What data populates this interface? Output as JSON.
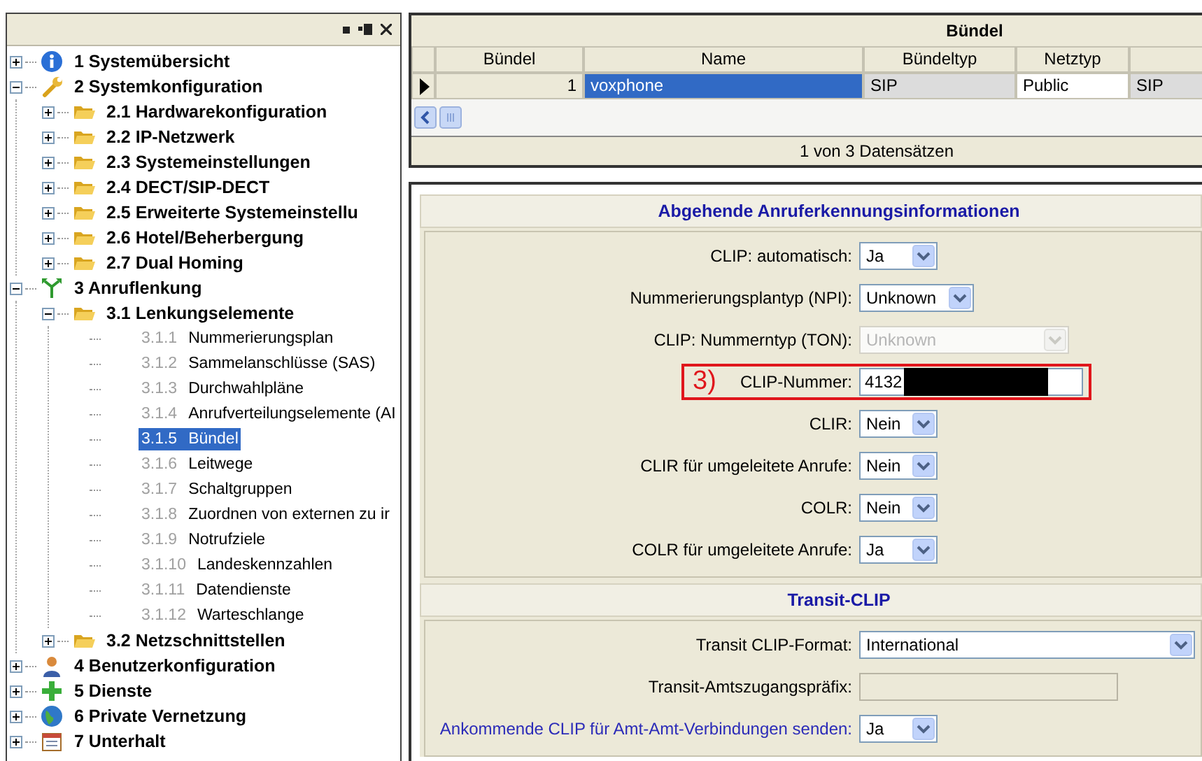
{
  "tree": [
    {
      "kind": "info",
      "label": "1 Systemübersicht",
      "expanded": false,
      "selected": false
    },
    {
      "kind": "wrench",
      "label": "2 Systemkonfiguration",
      "expanded": true,
      "selected": false,
      "children": [
        {
          "kind": "folder",
          "label": "2.1 Hardwarekonfiguration",
          "expanded": false,
          "selected": false
        },
        {
          "kind": "folder",
          "label": "2.2 IP-Netzwerk",
          "expanded": false,
          "selected": false
        },
        {
          "kind": "folder",
          "label": "2.3 Systemeinstellungen",
          "expanded": false,
          "selected": false
        },
        {
          "kind": "folder",
          "label": "2.4 DECT/SIP-DECT",
          "expanded": false,
          "selected": false
        },
        {
          "kind": "folder",
          "label": "2.5 Erweiterte Systemeinstellu",
          "expanded": false,
          "selected": false
        },
        {
          "kind": "folder",
          "label": "2.6 Hotel/Beherbergung",
          "expanded": false,
          "selected": false
        },
        {
          "kind": "folder",
          "label": "2.7 Dual Homing",
          "expanded": false,
          "selected": false
        }
      ]
    },
    {
      "kind": "routing",
      "label": "3 Anruflenkung",
      "expanded": true,
      "selected": false,
      "children": [
        {
          "kind": "folder",
          "label": "3.1 Lenkungselemente",
          "expanded": true,
          "selected": false,
          "children": [
            {
              "kind": "page",
              "number": "3.1.1",
              "label": "Nummerierungsplan",
              "selected": false
            },
            {
              "kind": "page",
              "number": "3.1.2",
              "label": "Sammelanschlüsse (SAS)",
              "selected": false
            },
            {
              "kind": "page",
              "number": "3.1.3",
              "label": "Durchwahlpläne",
              "selected": false
            },
            {
              "kind": "page",
              "number": "3.1.4",
              "label": "Anrufverteilungselemente (AI",
              "selected": false
            },
            {
              "kind": "page",
              "number": "3.1.5",
              "label": "Bündel",
              "selected": true
            },
            {
              "kind": "page",
              "number": "3.1.6",
              "label": "Leitwege",
              "selected": false
            },
            {
              "kind": "page",
              "number": "3.1.7",
              "label": "Schaltgruppen",
              "selected": false
            },
            {
              "kind": "page",
              "number": "3.1.8",
              "label": "Zuordnen von externen zu ir",
              "selected": false
            },
            {
              "kind": "page",
              "number": "3.1.9",
              "label": "Notrufziele",
              "selected": false
            },
            {
              "kind": "page",
              "number": "3.1.10",
              "label": "Landeskennzahlen",
              "selected": false
            },
            {
              "kind": "page",
              "number": "3.1.11",
              "label": "Datendienste",
              "selected": false
            },
            {
              "kind": "page",
              "number": "3.1.12",
              "label": "Warteschlange",
              "selected": false
            }
          ]
        },
        {
          "kind": "folder",
          "label": "3.2 Netzschnittstellen",
          "expanded": false,
          "selected": false
        }
      ]
    },
    {
      "kind": "user",
      "label": "4 Benutzerkonfiguration",
      "expanded": false,
      "selected": false
    },
    {
      "kind": "plus",
      "label": "5 Dienste",
      "expanded": false,
      "selected": false
    },
    {
      "kind": "globe",
      "label": "6 Private Vernetzung",
      "expanded": false,
      "selected": false
    },
    {
      "kind": "calendar",
      "label": "7 Unterhalt",
      "expanded": false,
      "selected": false
    }
  ],
  "grid": {
    "title": "Bündel",
    "columns": [
      "Bündel",
      "Name",
      "Bündeltyp",
      "Netztyp"
    ],
    "rows": [
      {
        "selected": true,
        "cells": [
          {
            "text": "1",
            "kind": "number"
          },
          {
            "text": "voxphone",
            "kind": "focused"
          },
          {
            "text": "SIP",
            "kind": "readonly"
          },
          {
            "text": "Public",
            "kind": "edit"
          },
          {
            "text": "SIP",
            "kind": "readonly"
          }
        ]
      }
    ],
    "records": "1 von 3 Datensätzen"
  },
  "sections": [
    {
      "title": "Abgehende Anruferkennungsinformationen",
      "fields": [
        {
          "label": "CLIP: automatisch:",
          "kind": "choice",
          "value": "Ja",
          "disabled": false,
          "highlighted": false
        },
        {
          "label": "Nummerierungsplantyp (NPI):",
          "kind": "dropdown",
          "value": "Unknown",
          "disabled": false,
          "highlighted": false
        },
        {
          "label": "CLIP: Nummerntyp (TON):",
          "kind": "list",
          "value": "Unknown",
          "disabled": true,
          "highlighted": false
        },
        {
          "label": "CLIP-Nummer:",
          "kind": "text",
          "value": "4132",
          "redacted": true,
          "annotation": "3)",
          "disabled": false,
          "highlighted": false
        },
        {
          "label": "CLIR:",
          "kind": "choice",
          "value": "Nein",
          "disabled": false,
          "highlighted": false
        },
        {
          "label": "CLIR für umgeleitete Anrufe:",
          "kind": "choice",
          "value": "Nein",
          "disabled": false,
          "highlighted": false
        },
        {
          "label": "COLR:",
          "kind": "choice",
          "value": "Nein",
          "disabled": false,
          "highlighted": false
        },
        {
          "label": "COLR für umgeleitete Anrufe:",
          "kind": "choice",
          "value": "Ja",
          "disabled": false,
          "highlighted": false
        }
      ]
    },
    {
      "title": "Transit-CLIP",
      "fields": [
        {
          "label": "Transit CLIP-Format:",
          "kind": "wide",
          "value": "International",
          "disabled": false,
          "highlighted": false
        },
        {
          "label": "Transit-Amtszugangspräfix:",
          "kind": "text",
          "disabled": true,
          "highlighted": false
        },
        {
          "label": "Ankommende CLIP für Amt-Amt-Verbindungen senden:",
          "kind": "choice",
          "value": "Ja",
          "disabled": false,
          "highlighted": true
        }
      ]
    }
  ]
}
